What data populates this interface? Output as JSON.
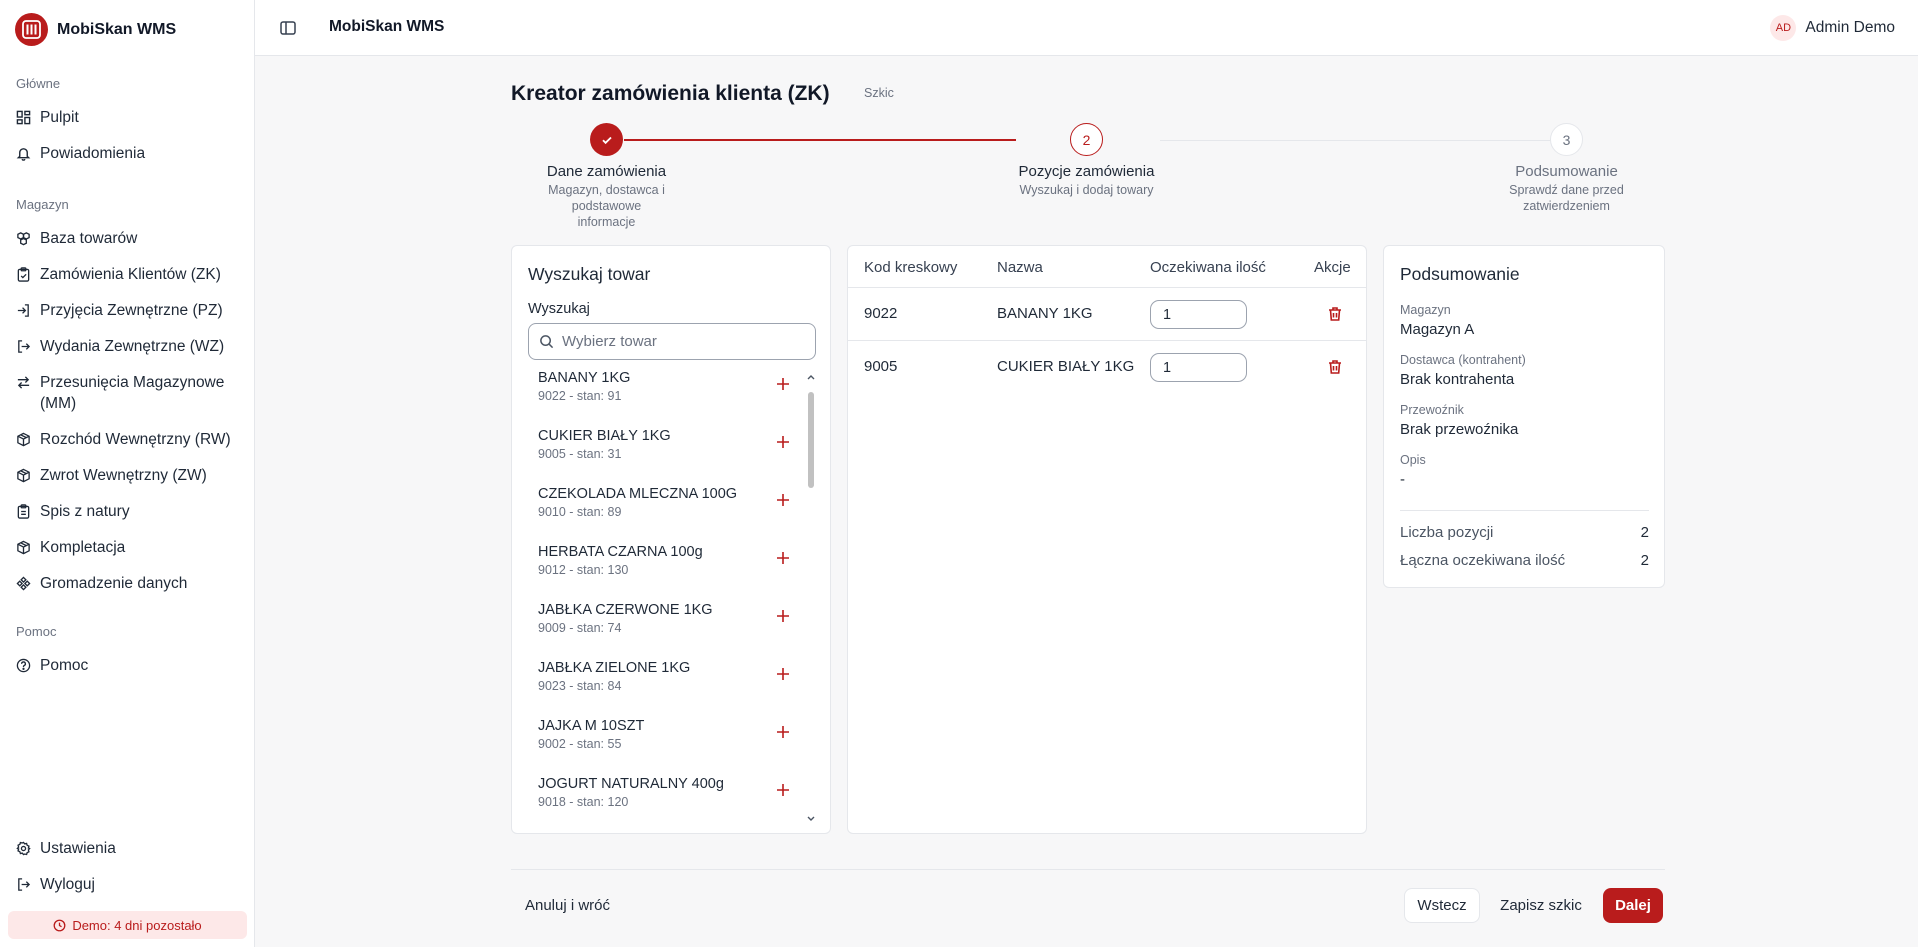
{
  "app": {
    "name": "MobiSkan WMS"
  },
  "topbar": {
    "title": "MobiSkan WMS",
    "user_initials": "AD",
    "user_name": "Admin Demo"
  },
  "sidebar": {
    "sections": [
      {
        "title": "Główne",
        "items": [
          {
            "label": "Pulpit",
            "icon": "dashboard-icon"
          },
          {
            "label": "Powiadomienia",
            "icon": "bell-icon"
          }
        ]
      },
      {
        "title": "Magazyn",
        "items": [
          {
            "label": "Baza towarów",
            "icon": "boxes-icon"
          },
          {
            "label": "Zamówienia Klientów (ZK)",
            "icon": "clipboard-icon"
          },
          {
            "label": "Przyjęcia Zewnętrzne (PZ)",
            "icon": "login-icon"
          },
          {
            "label": "Wydania Zewnętrzne (WZ)",
            "icon": "logout-icon"
          },
          {
            "label": "Przesunięcia Magazynowe (MM)",
            "icon": "transfer-icon"
          },
          {
            "label": "Rozchód Wewnętrzny (RW)",
            "icon": "package-icon"
          },
          {
            "label": "Zwrot Wewnętrzny (ZW)",
            "icon": "package-icon"
          },
          {
            "label": "Spis z natury",
            "icon": "clipboard-list-icon"
          },
          {
            "label": "Kompletacja",
            "icon": "package-icon"
          },
          {
            "label": "Gromadzenie danych",
            "icon": "workflow-icon"
          }
        ]
      },
      {
        "title": "Pomoc",
        "items": [
          {
            "label": "Pomoc",
            "icon": "help-circle-icon"
          }
        ]
      }
    ],
    "bottom": [
      {
        "label": "Ustawienia",
        "icon": "gear-icon"
      },
      {
        "label": "Wyloguj",
        "icon": "logout-icon"
      }
    ],
    "demo_badge": "Demo: 4 dni pozostało"
  },
  "page": {
    "title": "Kreator zamówienia klienta (ZK)",
    "status": "Szkic"
  },
  "stepper": [
    {
      "number": "1",
      "title": "Dane zamówienia",
      "desc_lines": [
        "Magazyn, dostawca i",
        "podstawowe",
        "informacje"
      ],
      "state": "done"
    },
    {
      "number": "2",
      "title": "Pozycje zamówienia",
      "desc_lines": [
        "Wyszukaj i dodaj towary"
      ],
      "state": "active"
    },
    {
      "number": "3",
      "title": "Podsumowanie",
      "desc_lines": [
        "Sprawdź dane przed",
        "zatwierdzeniem"
      ],
      "state": "pending"
    }
  ],
  "search": {
    "title": "Wyszukaj towar",
    "label": "Wyszukaj",
    "placeholder": "Wybierz towar",
    "products": [
      {
        "name": "BANANY 1KG",
        "meta": "9022 - stan: 91"
      },
      {
        "name": "CUKIER BIAŁY 1KG",
        "meta": "9005 - stan: 31"
      },
      {
        "name": "CZEKOLADA MLECZNA 100G",
        "meta": "9010 - stan: 89"
      },
      {
        "name": "HERBATA CZARNA 100g",
        "meta": "9012 - stan: 130"
      },
      {
        "name": "JABŁKA CZERWONE 1KG",
        "meta": "9009 - stan: 74"
      },
      {
        "name": "JABŁKA ZIELONE 1KG",
        "meta": "9023 - stan: 84"
      },
      {
        "name": "JAJKA M 10SZT",
        "meta": "9002 - stan: 55"
      },
      {
        "name": "JOGURT NATURALNY 400g",
        "meta": "9018 - stan: 120"
      }
    ]
  },
  "table": {
    "headers": [
      "Kod kreskowy",
      "Nazwa",
      "Oczekiwana ilość",
      "Akcje"
    ],
    "rows": [
      {
        "barcode": "9022",
        "name": "BANANY 1KG",
        "qty": "1"
      },
      {
        "barcode": "9005",
        "name": "CUKIER BIAŁY 1KG",
        "qty": "1"
      }
    ]
  },
  "summary": {
    "title": "Podsumowanie",
    "fields": [
      {
        "label": "Magazyn",
        "value": "Magazyn A"
      },
      {
        "label": "Dostawca (kontrahent)",
        "value": "Brak kontrahenta"
      },
      {
        "label": "Przewoźnik",
        "value": "Brak przewoźnika"
      },
      {
        "label": "Opis",
        "value": "-"
      }
    ],
    "totals": [
      {
        "label": "Liczba pozycji",
        "value": "2"
      },
      {
        "label": "Łączna oczekiwana ilość",
        "value": "2"
      }
    ]
  },
  "footer": {
    "cancel": "Anuluj i wróć",
    "back": "Wstecz",
    "save_draft": "Zapisz szkic",
    "next": "Dalej"
  },
  "colors": {
    "accent": "#b91c1c",
    "accent_light": "#fde8e8"
  }
}
